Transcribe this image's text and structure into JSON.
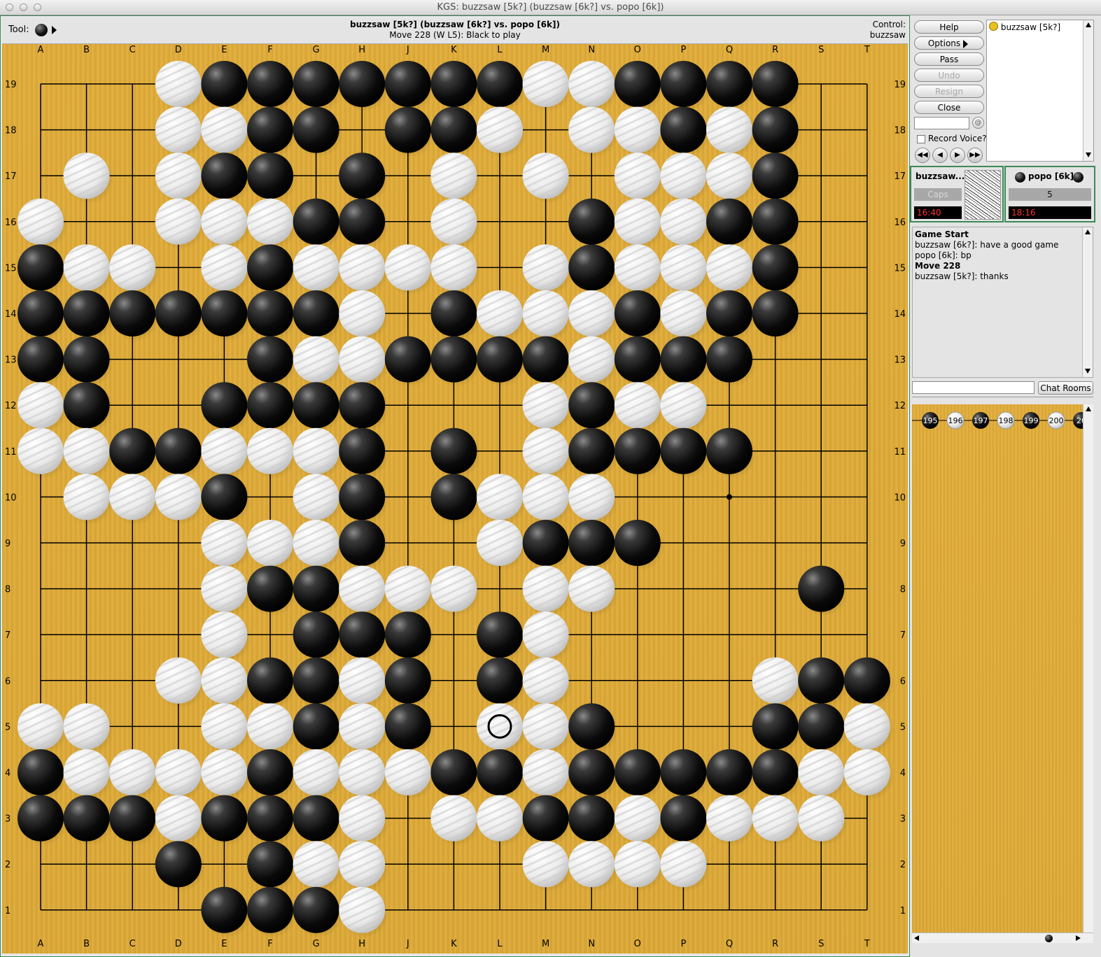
{
  "window": {
    "title": "KGS: buzzsaw [5k?] (buzzsaw [6k?] vs. popo [6k])"
  },
  "info": {
    "tool_label": "Tool:",
    "game_title": "buzzsaw [5k?] (buzzsaw [6k?] vs. popo [6k])",
    "move_status": "Move 228 (W L5): Black to play",
    "control_label": "Control:",
    "control_user": "buzzsaw"
  },
  "board": {
    "size": 19,
    "columns": [
      "A",
      "B",
      "C",
      "D",
      "E",
      "F",
      "G",
      "H",
      "J",
      "K",
      "L",
      "M",
      "N",
      "O",
      "P",
      "Q",
      "R",
      "S",
      "T"
    ],
    "rows": [
      "19",
      "18",
      "17",
      "16",
      "15",
      "14",
      "13",
      "12",
      "11",
      "10",
      "9",
      "8",
      "7",
      "6",
      "5",
      "4",
      "3",
      "2",
      "1"
    ],
    "stones": [
      "...WBBBBBBBWWBBBB..",
      "...WWBB.BBW.WWBWB..",
      ".W.WBB.B.W.W.WWWB..",
      "W..WWWBB.W..BWWBB..",
      "BWW.WBWWWW.WBWWWB..",
      "BBBBBBBW.BWWWBWBB..",
      "BB...BWWBBBBWBBB...",
      "WB..BBBB...WBWW....",
      "WWBBWWWB.B.WBBBB...",
      ".WWWB.WB.BWWW......",
      "....WWWB..WBBB.....",
      "....WBBWWW.WW....B.",
      "....W.BBB.BW.......",
      "...WWBBWB.BW....WBB",
      "WW..WWBWB.WWB...BBW",
      "BWWWWBWWWBBWBBBBBWW",
      "BBBWBBBW.WWBBWBWWW.",
      "...B.BWW...WWWW....",
      "....BBBW..........."
    ],
    "last_move": "L5",
    "hoshi": [
      "Q10"
    ]
  },
  "side": {
    "buttons": {
      "help": "Help",
      "options": "Options",
      "pass": "Pass",
      "undo": "Undo",
      "resign": "Resign",
      "close": "Close"
    },
    "record_voice": "Record Voice?",
    "users": [
      "buzzsaw [5k?]"
    ],
    "white_player": {
      "name": "buzzsaw...",
      "caps": "Caps",
      "time": "16:40"
    },
    "black_player": {
      "name": "popo [6k]",
      "caps": "5",
      "time": "18:16"
    },
    "chat": [
      {
        "text": "Game Start",
        "bold": true
      },
      {
        "text": "buzzsaw [6k?]: have a good game",
        "bold": false
      },
      {
        "text": "popo [6k]: bp",
        "bold": false
      },
      {
        "text": "Move 228",
        "bold": true
      },
      {
        "text": "buzzsaw [5k?]: thanks",
        "bold": false
      }
    ],
    "chat_rooms": "Chat Rooms",
    "tree_moves": [
      {
        "n": "195",
        "c": "B"
      },
      {
        "n": "196",
        "c": "W"
      },
      {
        "n": "197",
        "c": "B"
      },
      {
        "n": "198",
        "c": "W"
      },
      {
        "n": "199",
        "c": "B"
      },
      {
        "n": "200",
        "c": "W"
      },
      {
        "n": "20",
        "c": "B"
      }
    ]
  },
  "colors": {
    "board": "#dcaa3a",
    "panel_border": "#3c8a55",
    "clock_text": "#ff3030"
  }
}
